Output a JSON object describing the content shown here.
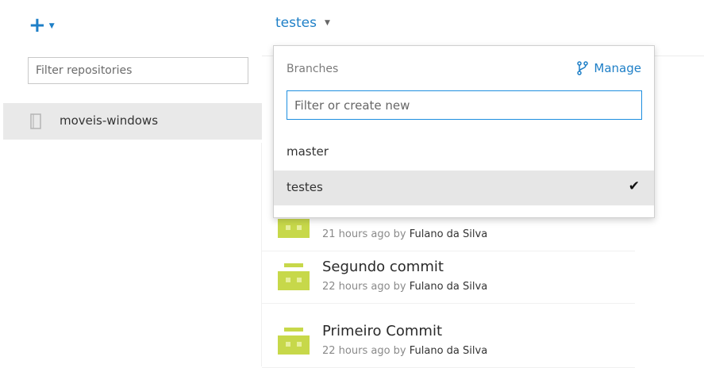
{
  "header": {
    "add_icon": "plus-icon",
    "branch_current": "testes"
  },
  "repos": {
    "filter_placeholder": "Filter repositories",
    "items": [
      {
        "name": "moveis-windows",
        "icon": "repository-book-icon"
      }
    ]
  },
  "branch_dropdown": {
    "label": "Branches",
    "manage_label": "Manage",
    "manage_icon": "branch-icon",
    "filter_placeholder": "Filter or create new",
    "branches": [
      {
        "name": "master",
        "selected": false
      },
      {
        "name": "testes",
        "selected": true
      }
    ],
    "check_glyph": "✔"
  },
  "commits": [
    {
      "title": "",
      "time": "21 hours ago",
      "by": "by",
      "author": "Fulano da Silva"
    },
    {
      "title": "Segundo commit",
      "time": "22 hours ago",
      "by": "by",
      "author": "Fulano da Silva"
    },
    {
      "title": "Primeiro Commit",
      "time": "22 hours ago",
      "by": "by",
      "author": "Fulano da Silva"
    }
  ],
  "colors": {
    "accent": "#1e7fc7",
    "avatar": "#c7d84a",
    "selected_row": "#e6e6e6"
  }
}
